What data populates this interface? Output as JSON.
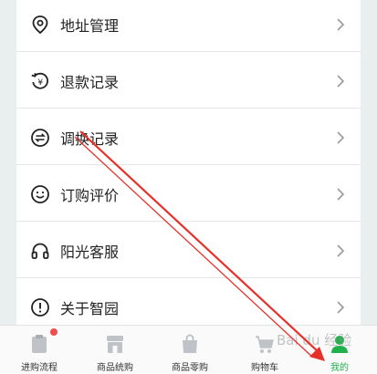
{
  "menu": {
    "items": [
      {
        "label": "地址管理",
        "icon": "location-pin-icon"
      },
      {
        "label": "退款记录",
        "icon": "refund-icon"
      },
      {
        "label": "调换记录",
        "icon": "exchange-icon"
      },
      {
        "label": "订购评价",
        "icon": "smiley-icon"
      },
      {
        "label": "阳光客服",
        "icon": "headset-icon"
      },
      {
        "label": "关于智园",
        "icon": "info-icon"
      }
    ]
  },
  "tabbar": {
    "tabs": [
      {
        "label": "进购流程",
        "icon": "clipboard-icon",
        "badge": true
      },
      {
        "label": "商品统购",
        "icon": "store-icon"
      },
      {
        "label": "商品零购",
        "icon": "bag-icon"
      },
      {
        "label": "购物车",
        "icon": "cart-icon"
      },
      {
        "label": "我的",
        "icon": "profile-icon",
        "active": true
      }
    ]
  },
  "watermark": {
    "text": "Bai du 经验"
  },
  "colors": {
    "accent": "#1fb24a",
    "arrow": "#e8302a",
    "badge": "#f24d4d"
  }
}
